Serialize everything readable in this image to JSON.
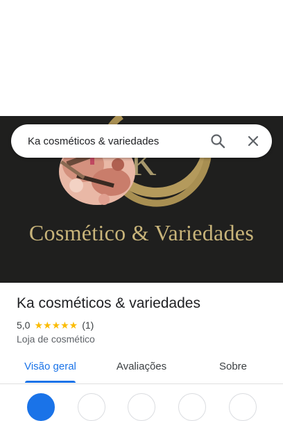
{
  "search": {
    "value": "Ka cosméticos & variedades",
    "search_icon": "search-icon",
    "close_icon": "close-icon"
  },
  "hero": {
    "logo_text": "Cosmético & Variedades"
  },
  "place": {
    "name": "Ka cosméticos & variedades",
    "rating_value": "5,0",
    "stars": "★★★★★",
    "rating_fraction": 1.0,
    "review_count": "(1)",
    "category": "Loja de cosmético"
  },
  "tabs": [
    {
      "label": "Visão geral",
      "active": true
    },
    {
      "label": "Avaliações",
      "active": false
    },
    {
      "label": "Sobre",
      "active": false
    }
  ],
  "colors": {
    "accent": "#1a73e8",
    "star": "#fbbc04",
    "hero_bg": "#1f1f1e",
    "logo_gold": "#c8b47a"
  }
}
